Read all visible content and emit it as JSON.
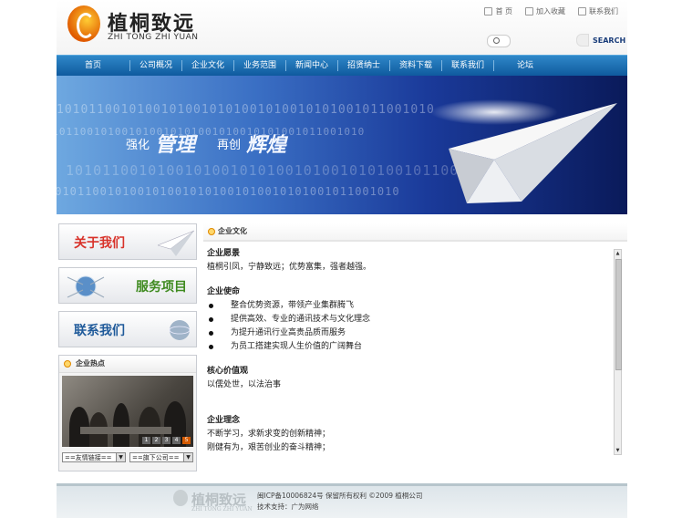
{
  "header": {
    "logo_cn": "植桐致远",
    "logo_en": "ZHI TONG ZHI YUAN",
    "toplinks": [
      "首 页",
      "加入收藏",
      "联系我们"
    ],
    "search_label": "SEARCH"
  },
  "nav": {
    "items": [
      "首页",
      "公司概况",
      "企业文化",
      "业务范围",
      "新闻中心",
      "招贤纳士",
      "资料下载",
      "联系我们",
      "论坛"
    ]
  },
  "banner": {
    "slogan_1": "强化",
    "slogan_2": "管理",
    "slogan_3": "再创",
    "slogan_4": "辉煌",
    "binary": "10101100101001010010101001010010101001011001010"
  },
  "sidebar": {
    "buttons": [
      {
        "label": "关于我们",
        "color": "#d8322a"
      },
      {
        "label": "服务项目",
        "color": "#3e8a1f"
      },
      {
        "label": "联系我们",
        "color": "#1f5a9a"
      }
    ],
    "hot_title": "企业热点",
    "thumbs": [
      "1",
      "2",
      "3",
      "4",
      "5"
    ],
    "select_links": "==友情链接==",
    "select_branch": "==旗下公司=="
  },
  "content": {
    "title": "企业文化",
    "vision_h": "企业愿景",
    "vision_text": "植桐引凤，宁静致远；优势富集，强者越强。",
    "mission_h": "企业使命",
    "mission_items": [
      "整合优势资源，带领产业集群腾飞",
      "提供高效、专业的通讯技术与文化理念",
      "为提升通讯行业高贵品质而服务",
      "为员工搭建实现人生价值的广阔舞台"
    ],
    "values_h": "核心价值观",
    "values_text": "以儒处世，以法治事",
    "concept_h": "企业理念",
    "concept_1": "不断学习，求新求变的创新精神；",
    "concept_2": "刚健有为，艰苦创业的奋斗精神；"
  },
  "footer": {
    "logo_cn": "植桐致远",
    "logo_en": "ZHI TONG ZHI YUAN",
    "line1": "闽ICP备10006824号  保留所有权利  ©2009  植桐公司",
    "line2": "技术支持：广为网络"
  },
  "colors": {
    "nav_top": "#2f88c9",
    "nav_bottom": "#0f5a9e",
    "accent_orange": "#e05a00"
  }
}
